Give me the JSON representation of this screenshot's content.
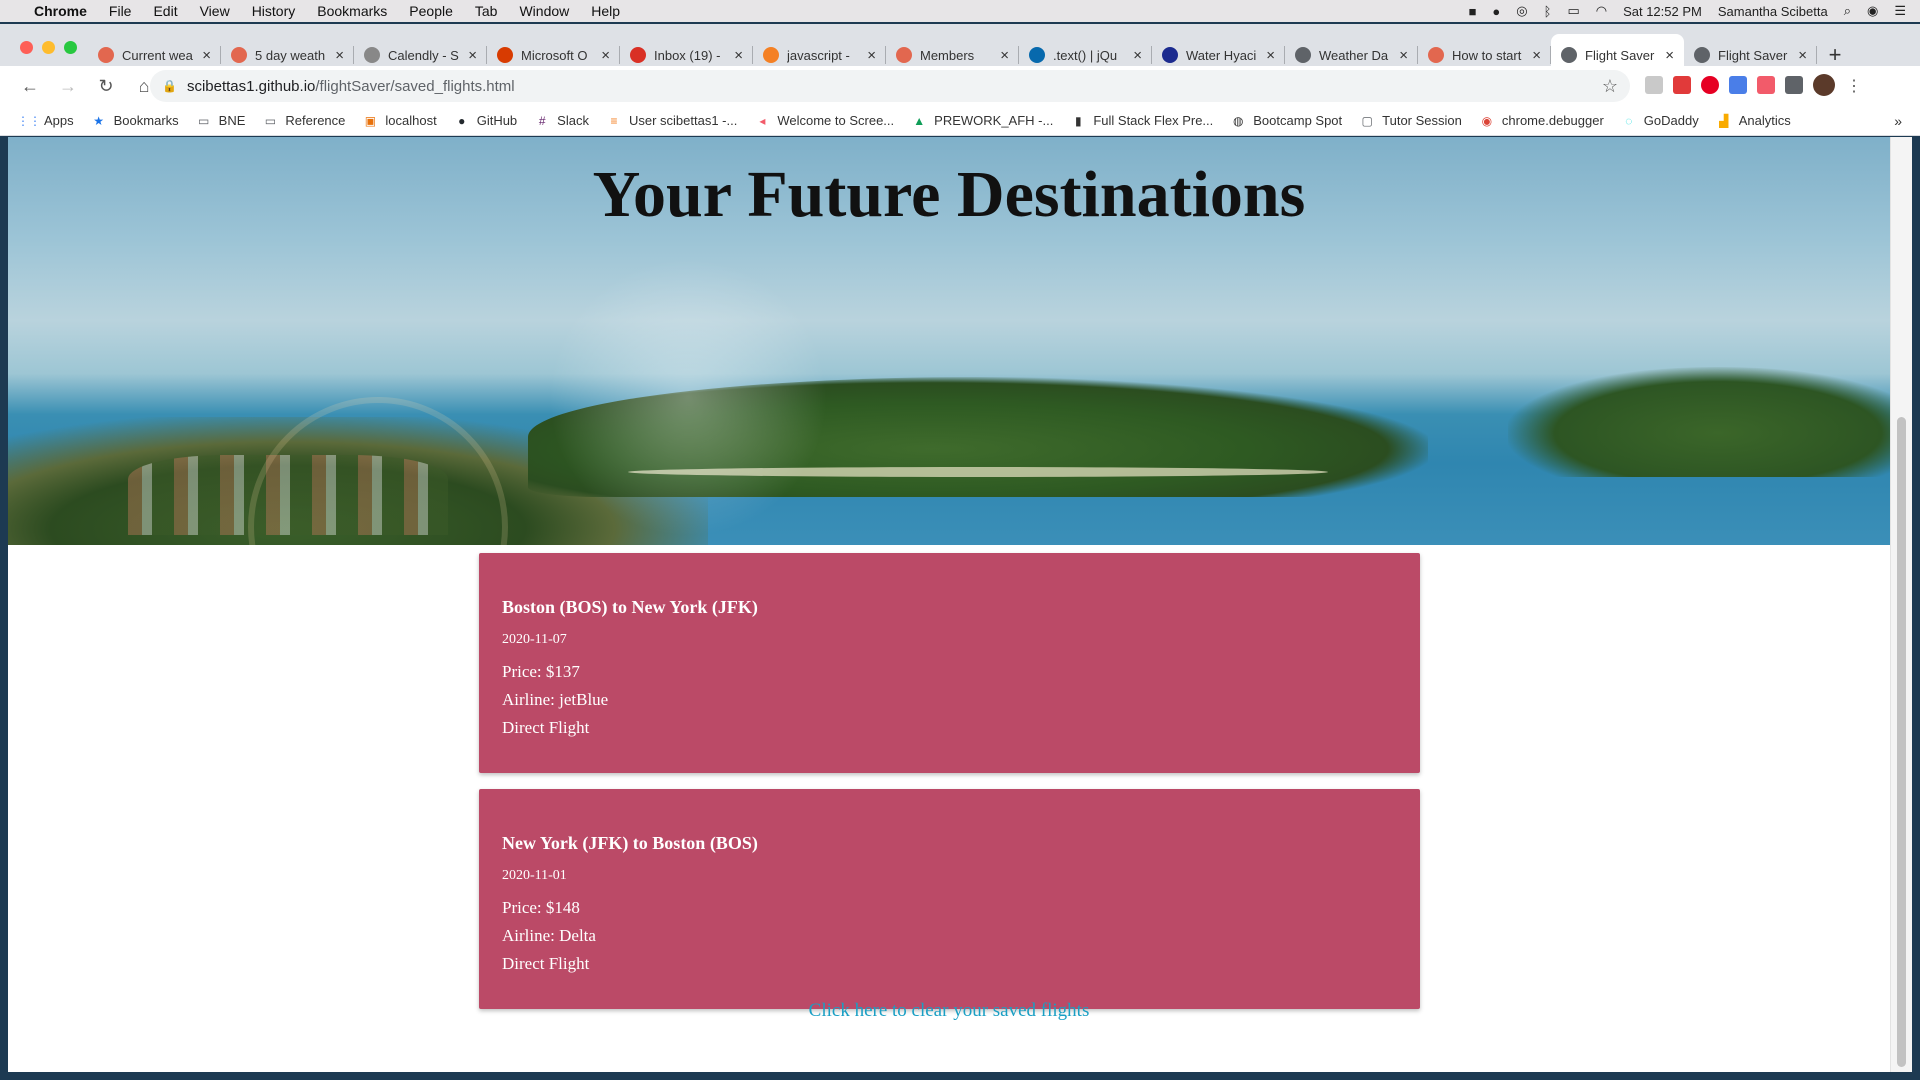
{
  "menubar": {
    "app": "Chrome",
    "items": [
      "File",
      "Edit",
      "View",
      "History",
      "Bookmarks",
      "People",
      "Tab",
      "Window",
      "Help"
    ],
    "clock": "Sat 12:52 PM",
    "user": "Samantha Scibetta"
  },
  "tabs": [
    {
      "label": "Current wea",
      "icon_color": "#e2674f"
    },
    {
      "label": "5 day weath",
      "icon_color": "#e2674f"
    },
    {
      "label": "Calendly - S",
      "icon_color": "#888888"
    },
    {
      "label": "Microsoft O",
      "icon_color": "#d83b01"
    },
    {
      "label": "Inbox (19) -",
      "icon_color": "#d93025"
    },
    {
      "label": "javascript -",
      "icon_color": "#f48024"
    },
    {
      "label": "Members",
      "icon_color": "#e2674f"
    },
    {
      "label": ".text() | jQu",
      "icon_color": "#0769ad"
    },
    {
      "label": "Water Hyaci",
      "icon_color": "#1c2b8f"
    },
    {
      "label": "Weather Da",
      "icon_color": "#5f6368"
    },
    {
      "label": "How to start",
      "icon_color": "#e2674f"
    },
    {
      "label": "Flight Saver",
      "icon_color": "#5f6368",
      "active": true
    },
    {
      "label": "Flight Saver",
      "icon_color": "#5f6368"
    }
  ],
  "address": {
    "domain": "scibettas1.github.io",
    "path": "/flightSaver/saved_flights.html"
  },
  "bookmarks": [
    {
      "label": "Apps",
      "icon": "apps-grid-icon"
    },
    {
      "label": "Bookmarks",
      "icon": "star-icon"
    },
    {
      "label": "BNE",
      "icon": "folder-icon"
    },
    {
      "label": "Reference",
      "icon": "folder-icon"
    },
    {
      "label": "localhost",
      "icon": "localhost-icon"
    },
    {
      "label": "GitHub",
      "icon": "github-icon"
    },
    {
      "label": "Slack",
      "icon": "slack-icon"
    },
    {
      "label": "User scibettas1 -...",
      "icon": "stackoverflow-icon"
    },
    {
      "label": "Welcome to Scree...",
      "icon": "screencastify-icon"
    },
    {
      "label": "PREWORK_AFH -...",
      "icon": "drive-icon"
    },
    {
      "label": "Full Stack Flex Pre...",
      "icon": "book-icon"
    },
    {
      "label": "Bootcamp Spot",
      "icon": "globe-icon"
    },
    {
      "label": "Tutor Session",
      "icon": "page-icon"
    },
    {
      "label": "chrome.debugger",
      "icon": "chrome-icon"
    },
    {
      "label": "GoDaddy",
      "icon": "godaddy-icon"
    },
    {
      "label": "Analytics",
      "icon": "analytics-icon"
    }
  ],
  "page": {
    "title": "Your Future Destinations",
    "flights": [
      {
        "route": "Boston (BOS) to New York (JFK)",
        "date": "2020-11-07",
        "price": "Price: $137",
        "airline": "Airline: jetBlue",
        "type": "Direct Flight"
      },
      {
        "route": "New York (JFK) to Boston (BOS)",
        "date": "2020-11-01",
        "price": "Price: $148",
        "airline": "Airline: Delta",
        "type": "Direct Flight"
      }
    ],
    "clear_link": "Click here to clear your saved flights"
  },
  "colors": {
    "card": "#bb4a67",
    "link": "#1a9fc4"
  }
}
